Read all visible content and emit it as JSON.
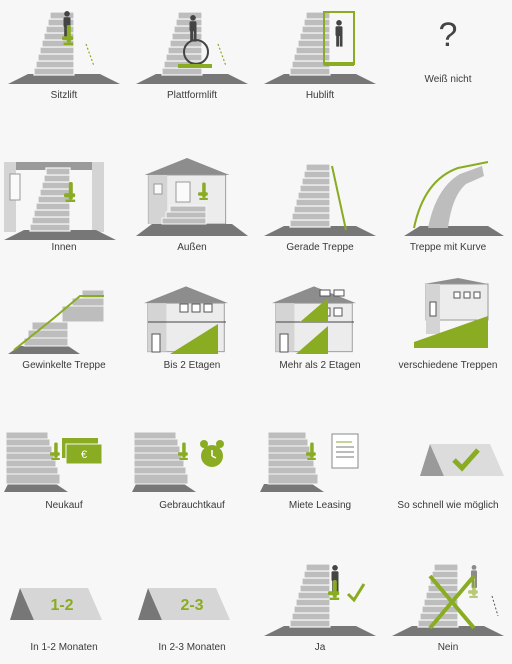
{
  "colors": {
    "accent": "#8aac22",
    "stairs": "#b9b9b9",
    "floor": "#777777",
    "text": "#3a3a3a"
  },
  "options": {
    "liftart": {
      "sitzlift": "Sitzlift",
      "plattformlift": "Plattformlift",
      "hublift": "Hublift",
      "weiss_nicht": "Weiß nicht",
      "weiss_nicht_glyph": "?"
    },
    "einsatzort": {
      "innen": "Innen",
      "aussen": "Außen",
      "gerade_treppe": "Gerade Treppe",
      "treppe_mit_kurve": "Treppe mit Kurve"
    },
    "treppenform": {
      "gewinkelte_treppe": "Gewinkelte Treppe",
      "bis_2_etagen": "Bis 2 Etagen",
      "mehr_als_2_etagen": "Mehr als 2 Etagen",
      "verschiedene_treppen": "verschiedene Treppen"
    },
    "finanzierung": {
      "neukauf": "Neukauf",
      "gebrauchtkauf": "Gebrauchtkauf",
      "miete_leasing": "Miete Leasing",
      "so_schnell": "So schnell wie möglich",
      "euro_symbol": "€"
    },
    "zeitraum": {
      "monate_1_2": "In 1-2 Monaten",
      "monate_1_2_sign": "1-2",
      "monate_2_3": "In 2-3 Monaten",
      "monate_2_3_sign": "2-3",
      "ja": "Ja",
      "nein": "Nein"
    }
  }
}
